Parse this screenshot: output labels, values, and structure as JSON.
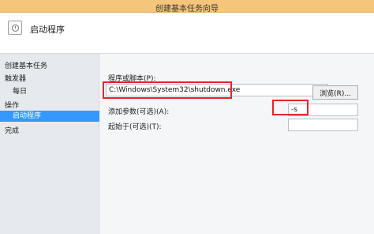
{
  "window": {
    "title": "创建基本任务向导"
  },
  "header": {
    "title": "启动程序",
    "icon": "scheduled-task-icon"
  },
  "nav": {
    "items": [
      {
        "label": "创建基本任务"
      },
      {
        "label": "触发器"
      },
      {
        "label": "每日"
      },
      {
        "label": "操作"
      },
      {
        "label": "启动程序"
      },
      {
        "label": "完成"
      }
    ]
  },
  "form": {
    "program_label": "程序或脚本(P):",
    "program_value": "C:\\Windows\\System32\\shutdown.exe",
    "browse_label": "浏览(R)...",
    "args_label": "添加参数(可选)(A):",
    "args_value": "-s",
    "startin_label": "起始于(可选)(T):",
    "startin_value": ""
  },
  "colors": {
    "highlight": "#e8232a",
    "selected": "#3399ff",
    "titlebar": "#f5c57c"
  }
}
